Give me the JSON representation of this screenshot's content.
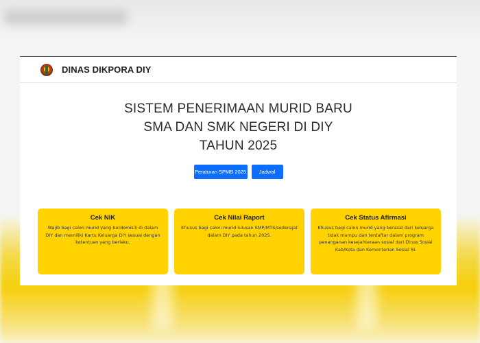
{
  "navbar": {
    "brand": "DINAS DIKPORA DIY",
    "logo_icon": "dikpora-emblem-icon"
  },
  "hero": {
    "title_lines": [
      "SISTEM PENERIMAAN MURID BARU",
      "SMA DAN SMK NEGERI DI DIY",
      "TAHUN 2025"
    ]
  },
  "buttons": {
    "regulation": "Peraturan SPMB 2025",
    "schedule": "Jadwal"
  },
  "features": [
    {
      "title": "Cek NIK",
      "text": "Wajib bagi calon murid yang berdomisili di dalam DIY dan memiliki Kartu Keluarga DIY sesuai dengan ketentuan yang berlaku."
    },
    {
      "title": "Cek Nilai Raport",
      "text": "Khusus bagi calon murid lulusan SMP/MTS/sederajat dalam DIY pada tahun 2025."
    },
    {
      "title": "Cek Status Afirmasi",
      "text": "Khusus bagi calon murid yang berasal dari keluarga tidak mampu dan terdaftar dalam program penanganan kesejahteraan sosial dari Dinas Sosial Kab/Kota dan Kementerian Sosial RI."
    }
  ],
  "colors": {
    "primary": "#0d6efd",
    "card_yellow": "#ffd200",
    "text_dark": "#2b2b2b"
  }
}
